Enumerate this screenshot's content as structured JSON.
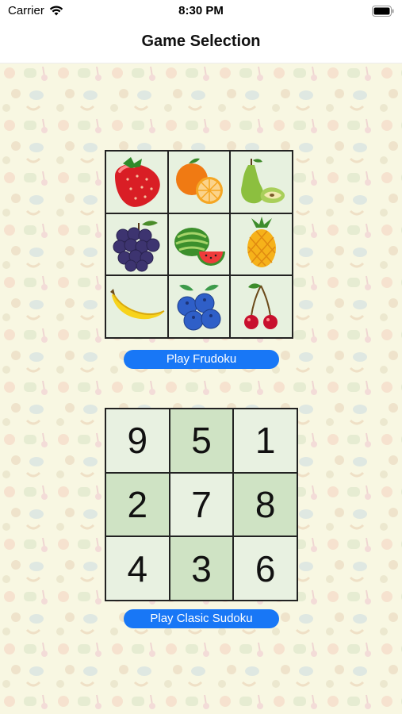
{
  "status_bar": {
    "carrier": "Carrier",
    "time": "8:30 PM",
    "wifi_icon": "wifi-icon",
    "battery_icon": "battery-icon"
  },
  "nav": {
    "title": "Game Selection"
  },
  "frudoku": {
    "cells": [
      {
        "name": "strawberry",
        "icon": "strawberry-icon"
      },
      {
        "name": "orange",
        "icon": "orange-icon"
      },
      {
        "name": "pear",
        "icon": "pear-icon"
      },
      {
        "name": "grapes",
        "icon": "grapes-icon"
      },
      {
        "name": "watermelon",
        "icon": "watermelon-icon"
      },
      {
        "name": "pineapple",
        "icon": "pineapple-icon"
      },
      {
        "name": "banana",
        "icon": "banana-icon"
      },
      {
        "name": "blueberries",
        "icon": "blueberries-icon"
      },
      {
        "name": "cherries",
        "icon": "cherries-icon"
      }
    ],
    "button_label": "Play Frudoku"
  },
  "classic": {
    "cells": [
      "9",
      "5",
      "1",
      "2",
      "7",
      "8",
      "4",
      "3",
      "6"
    ],
    "button_label": "Play Clasic Sudoku"
  },
  "colors": {
    "accent": "#1877f6",
    "background": "#f8f7e2",
    "cell_light": "#e8f1e1",
    "cell_dark": "#cfe3c4"
  }
}
